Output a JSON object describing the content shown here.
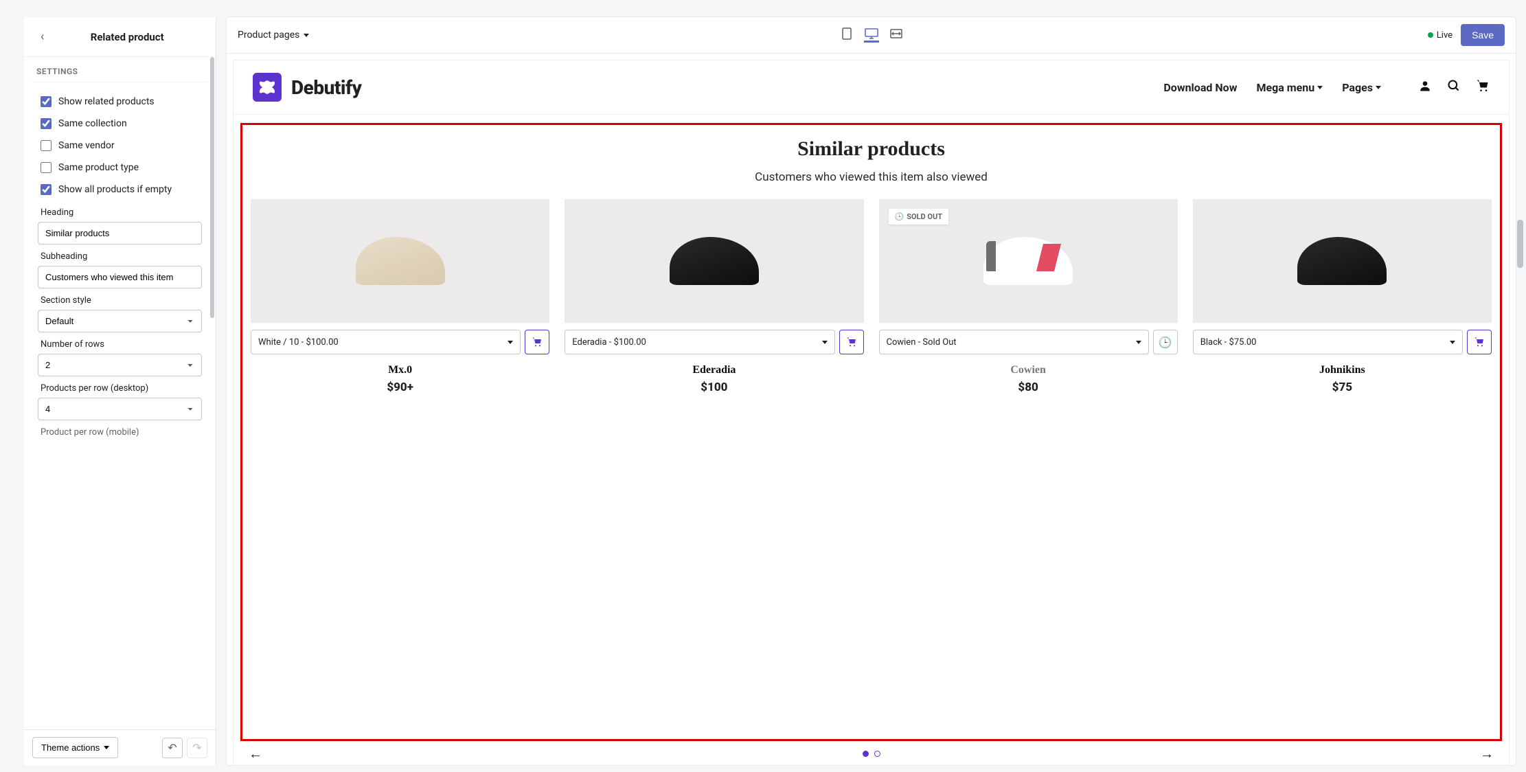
{
  "sidebar": {
    "title": "Related product",
    "settings_label": "SETTINGS",
    "checks": {
      "show_related": "Show related products",
      "same_collection": "Same collection",
      "same_vendor": "Same vendor",
      "same_product_type": "Same product type",
      "show_all_if_empty": "Show all products if empty"
    },
    "fields": {
      "heading_label": "Heading",
      "heading_value": "Similar products",
      "subheading_label": "Subheading",
      "subheading_value": "Customers who viewed this item",
      "section_style_label": "Section style",
      "section_style_value": "Default",
      "rows_label": "Number of rows",
      "rows_value": "2",
      "per_row_desktop_label": "Products per row (desktop)",
      "per_row_desktop_value": "4",
      "per_row_mobile_label": "Product per row (mobile)"
    },
    "footer": {
      "theme_actions": "Theme actions"
    }
  },
  "topbar": {
    "breadcrumb": "Product pages",
    "live": "Live",
    "save": "Save"
  },
  "site": {
    "brand": "Debutify",
    "nav": {
      "download": "Download Now",
      "mega": "Mega menu",
      "pages": "Pages"
    }
  },
  "section": {
    "heading": "Similar products",
    "sub": "Customers who viewed this item also viewed"
  },
  "products": [
    {
      "variant": "White / 10 - $100.00",
      "name": "Mx.0",
      "price": "$90+",
      "badge": ""
    },
    {
      "variant": "Ederadia - $100.00",
      "name": "Ederadia",
      "price": "$100",
      "badge": ""
    },
    {
      "variant": "Cowien - Sold Out",
      "name": "Cowien",
      "price": "$80",
      "badge": "SOLD OUT"
    },
    {
      "variant": "Black - $75.00",
      "name": "Johnikins",
      "price": "$75",
      "badge": ""
    }
  ]
}
